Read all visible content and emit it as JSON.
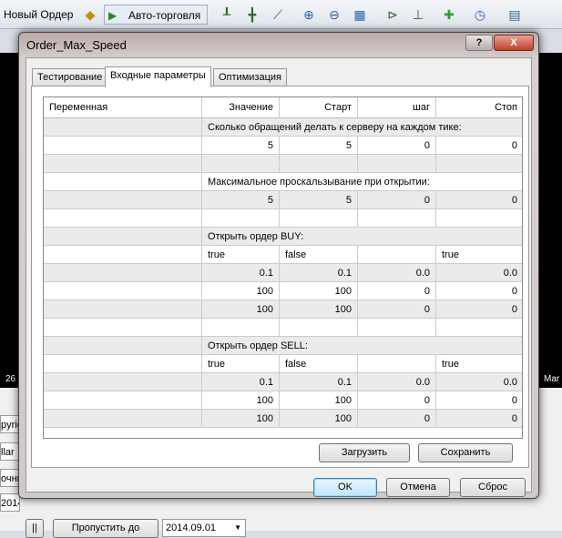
{
  "toolbar": {
    "new_order": "Новый Ордер",
    "auto_trading": "Авто-торговля"
  },
  "chart": {
    "left_date": "26",
    "right_date": "Mar"
  },
  "background": {
    "side_labels": [
      "pyrig",
      "llar",
      "очны",
      "2014"
    ],
    "skip_button": "Пропустить до",
    "date_value": "2014.09.01"
  },
  "dialog": {
    "title": "Order_Max_Speed",
    "help": "?",
    "close": "X",
    "tabs": [
      "Тестирование",
      "Входные параметры",
      "Оптимизация"
    ],
    "active_tab": 1,
    "table": {
      "headers": [
        "Переменная",
        "Значение",
        "Старт",
        "шаг",
        "Стоп"
      ],
      "rows": [
        {
          "span": "Сколько обращений делать к серверу на каждом тике:"
        },
        {
          "values": [
            "5",
            "5",
            "0",
            "0"
          ],
          "align": "right"
        },
        {
          "blank": true
        },
        {
          "span": "Максимальное проскальзывание при открытии:"
        },
        {
          "values": [
            "5",
            "5",
            "0",
            "0"
          ],
          "align": "right"
        },
        {
          "blank": true
        },
        {
          "span": "Открыть ордер BUY:"
        },
        {
          "values": [
            "true",
            "false",
            "",
            "true"
          ],
          "align": "left"
        },
        {
          "values": [
            "0.1",
            "0.1",
            "0.0",
            "0.0"
          ],
          "align": "right"
        },
        {
          "values": [
            "100",
            "100",
            "0",
            "0"
          ],
          "align": "right"
        },
        {
          "values": [
            "100",
            "100",
            "0",
            "0"
          ],
          "align": "right"
        },
        {
          "blank": true
        },
        {
          "span": "Открыть ордер SELL:"
        },
        {
          "values": [
            "true",
            "false",
            "",
            "true"
          ],
          "align": "left"
        },
        {
          "values": [
            "0.1",
            "0.1",
            "0.0",
            "0.0"
          ],
          "align": "right"
        },
        {
          "values": [
            "100",
            "100",
            "0",
            "0"
          ],
          "align": "right"
        },
        {
          "values": [
            "100",
            "100",
            "0",
            "0"
          ],
          "align": "right"
        }
      ]
    },
    "load_button": "Загрузить",
    "save_button": "Сохранить",
    "ok_button": "OK",
    "cancel_button": "Отмена",
    "reset_button": "Сброс"
  }
}
